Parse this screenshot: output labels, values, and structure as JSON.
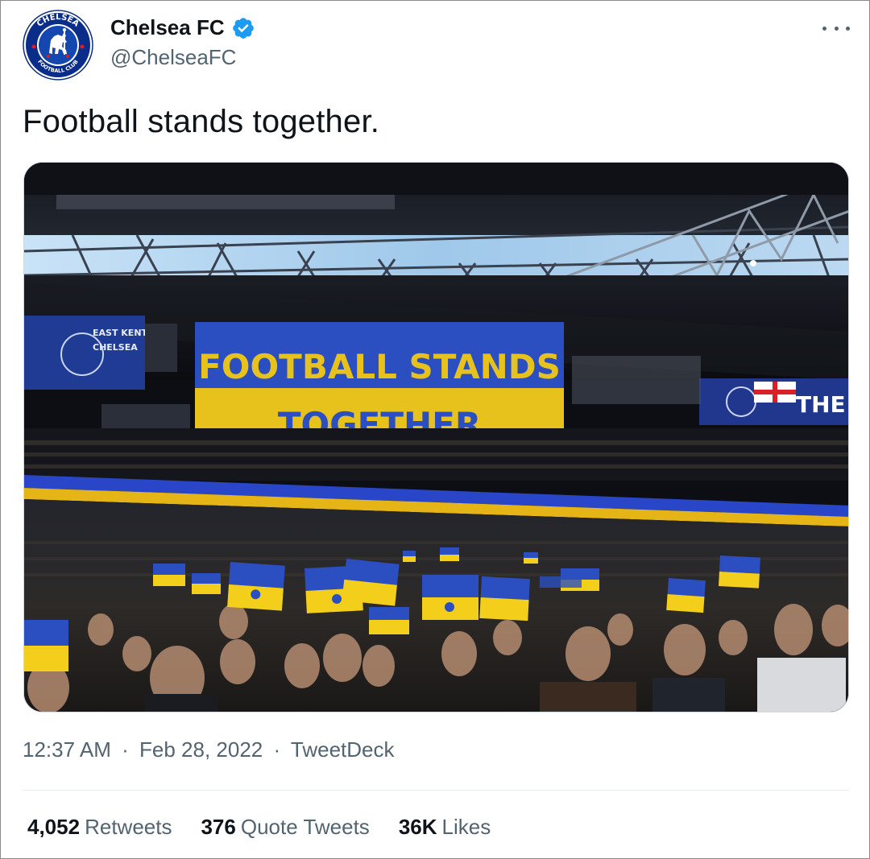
{
  "account": {
    "display_name": "Chelsea FC",
    "handle": "@ChelseaFC",
    "verified": true,
    "avatar_icon": "chelsea-crest-icon",
    "avatar_text_top": "CHELSEA",
    "avatar_text_bottom": "FOOTBALL CLUB"
  },
  "tweet": {
    "text": "Football stands together.",
    "time": "12:37 AM",
    "date": "Feb 28, 2022",
    "source": "TweetDeck",
    "separator": "·"
  },
  "media": {
    "banner_line1": "FOOTBALL STANDS",
    "banner_line2": "TOGETHER",
    "side_banner_right": "THE",
    "side_banner_left_top": "EAST KENT",
    "side_banner_left_bottom": "CHELSEA"
  },
  "stats": {
    "retweets_count": "4,052",
    "retweets_label": "Retweets",
    "quotes_count": "376",
    "quotes_label": "Quote Tweets",
    "likes_count": "36K",
    "likes_label": "Likes"
  },
  "colors": {
    "ukraine_blue": "#2b4fc0",
    "ukraine_yellow": "#f3cf1c",
    "verified_blue": "#1d9bf0",
    "chelsea_blue": "#034694"
  }
}
